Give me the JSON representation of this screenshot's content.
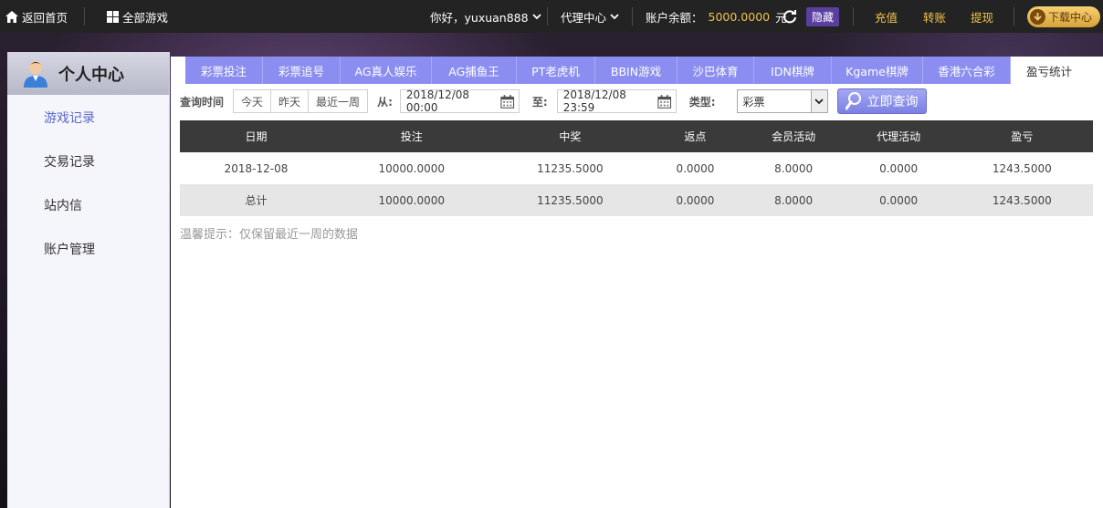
{
  "topbar": {
    "home": "返回首页",
    "all_games": "全部游戏",
    "greeting": "你好，yuxuan888",
    "agent_center": "代理中心",
    "balance_label": "账户余额：",
    "balance_value": "5000.0000",
    "balance_unit": "元",
    "hide": "隐藏",
    "recharge": "充值",
    "transfer": "转账",
    "withdraw": "提现",
    "download": "下载中心"
  },
  "sidebar": {
    "title": "个人中心",
    "items": [
      {
        "label": "游戏记录",
        "active": true
      },
      {
        "label": "交易记录",
        "active": false
      },
      {
        "label": "站内信",
        "active": false
      },
      {
        "label": "账户管理",
        "active": false
      }
    ]
  },
  "tabs": [
    "彩票投注",
    "彩票追号",
    "AG真人娱乐",
    "AG捕鱼王",
    "PT老虎机",
    "BBIN游戏",
    "沙巴体育",
    "IDN棋牌",
    "Kgame棋牌",
    "香港六合彩",
    "盈亏统计"
  ],
  "active_tab": "盈亏统计",
  "filter": {
    "query_time_label": "查询时间",
    "quick": [
      "今天",
      "昨天",
      "最近一周"
    ],
    "from_label": "从:",
    "from_value": "2018/12/08 00:00",
    "to_label": "至:",
    "to_value": "2018/12/08 23:59",
    "type_label": "类型:",
    "type_value": "彩票",
    "query_button": "立即查询"
  },
  "table": {
    "columns": [
      "日期",
      "投注",
      "中奖",
      "返点",
      "会员活动",
      "代理活动",
      "盈亏"
    ],
    "rows": [
      [
        "2018-12-08",
        "10000.0000",
        "11235.5000",
        "0.0000",
        "8.0000",
        "0.0000",
        "1243.5000"
      ],
      [
        "总计",
        "10000.0000",
        "11235.5000",
        "0.0000",
        "8.0000",
        "0.0000",
        "1243.5000"
      ]
    ]
  },
  "tip": "温馨提示：仅保留最近一周的数据",
  "colors": {
    "topbar_bg": "#232323",
    "accent_gold": "#f0c24a",
    "tab_bg": "#8b8ef0",
    "hide_bg": "#5a3fa0",
    "table_header_bg": "#3a3a3a"
  }
}
